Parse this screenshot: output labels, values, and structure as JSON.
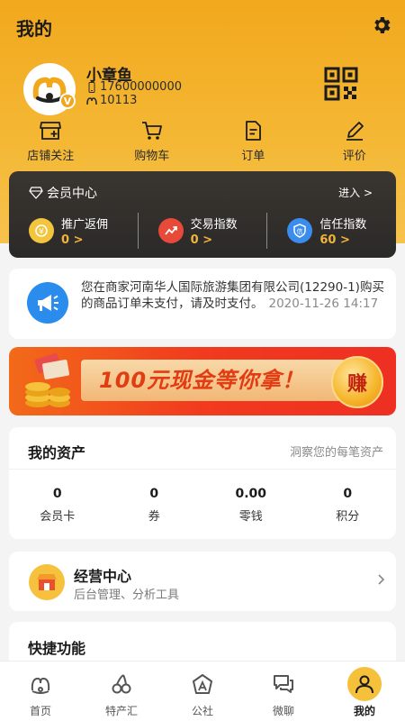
{
  "header": {
    "title": "我的"
  },
  "profile": {
    "name": "小章鱼",
    "phone": "17600000000",
    "user_id": "10113",
    "badge": "V"
  },
  "quick_actions": [
    {
      "label": "店铺关注",
      "icon": "store-icon"
    },
    {
      "label": "购物车",
      "icon": "cart-icon"
    },
    {
      "label": "订单",
      "icon": "order-icon"
    },
    {
      "label": "评价",
      "icon": "review-icon"
    }
  ],
  "vip": {
    "title": "会员中心",
    "enter": "进入 >",
    "stats": [
      {
        "label": "推广返佣",
        "value": "0 >",
        "color": "#f3c43e"
      },
      {
        "label": "交易指数",
        "value": "0 >",
        "color": "#e84a3a"
      },
      {
        "label": "信任指数",
        "value": "60 >",
        "color": "#3b8ded"
      }
    ]
  },
  "notice": {
    "text": "您在商家河南华人国际旅游集团有限公司(12290-1)购买的商品订单未支付，请及时支付。",
    "time": "2020-11-26 14:17"
  },
  "banner": {
    "text": "100元现金等你拿！",
    "button": "赚"
  },
  "assets": {
    "title": "我的资产",
    "subtitle": "洞察您的每笔资产",
    "items": [
      {
        "value": "0",
        "label": "会员卡"
      },
      {
        "value": "0",
        "label": "券"
      },
      {
        "value": "0.00",
        "label": "零钱"
      },
      {
        "value": "0",
        "label": "积分"
      }
    ]
  },
  "business": {
    "title": "经营中心",
    "subtitle": "后台管理、分析工具"
  },
  "shortcuts": {
    "title": "快捷功能"
  },
  "tabbar": [
    {
      "label": "首页"
    },
    {
      "label": "特产汇"
    },
    {
      "label": "公社"
    },
    {
      "label": "微聊"
    },
    {
      "label": "我的",
      "active": true
    }
  ],
  "colors": {
    "brand_yellow": "#f2a81d",
    "vip_dark": "#2f2c29",
    "vip_gold": "#f2b33b",
    "banner_red": "#ee2f22"
  }
}
